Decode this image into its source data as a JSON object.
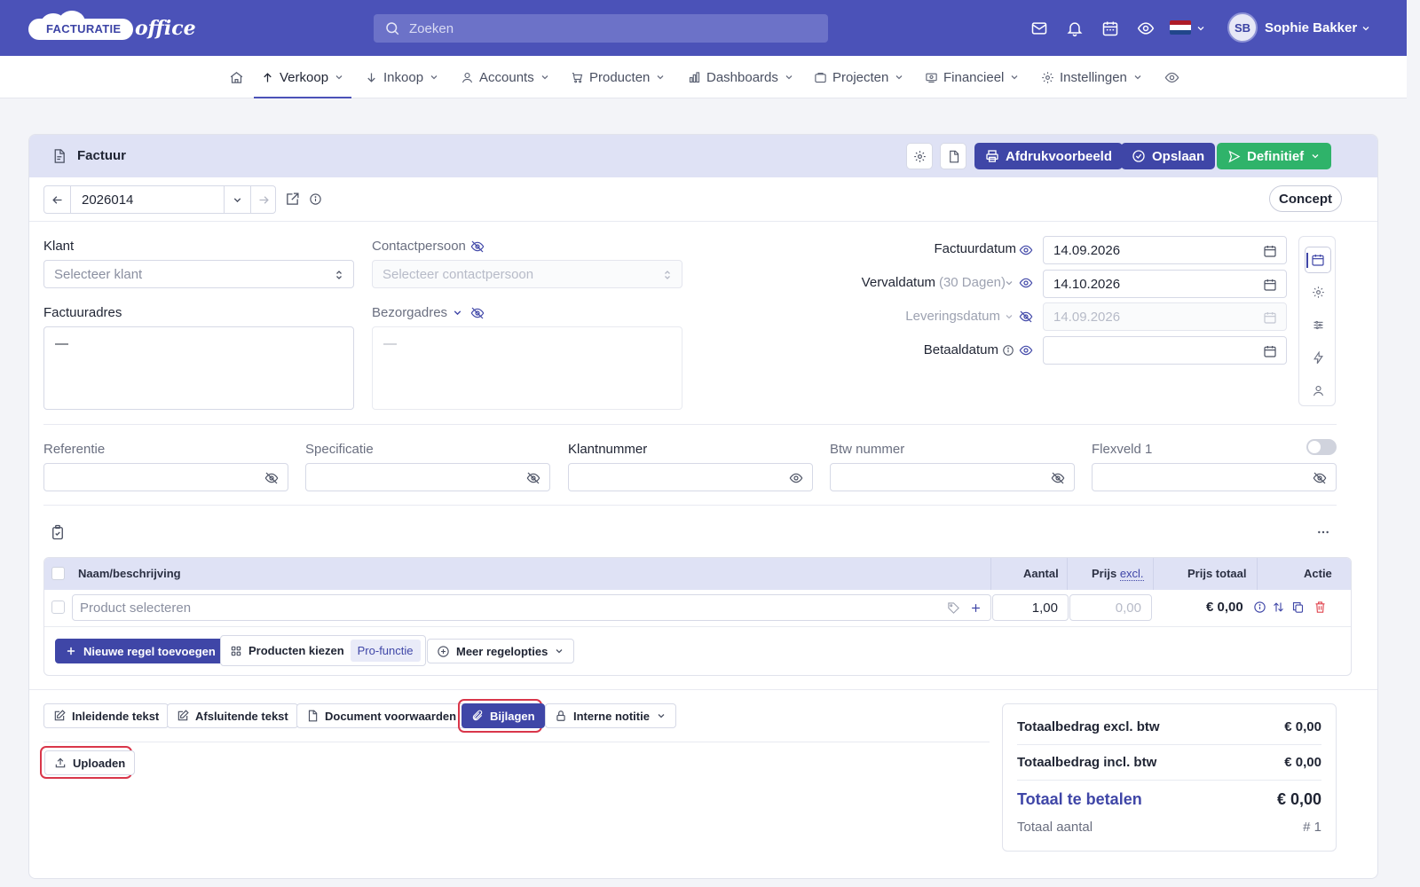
{
  "brand": {
    "logo_text": "FACTURATIE",
    "logo_script": "office"
  },
  "search": {
    "placeholder": "Zoeken"
  },
  "user": {
    "initials": "SB",
    "name": "Sophie Bakker"
  },
  "nav": {
    "items": [
      {
        "label": "Verkoop",
        "active": true
      },
      {
        "label": "Inkoop"
      },
      {
        "label": "Accounts"
      },
      {
        "label": "Producten"
      },
      {
        "label": "Dashboards"
      },
      {
        "label": "Projecten"
      },
      {
        "label": "Financieel"
      },
      {
        "label": "Instellingen"
      }
    ]
  },
  "doc": {
    "title": "Factuur",
    "number": "2026014",
    "status": "Concept",
    "buttons": {
      "preview": "Afdrukvoorbeeld",
      "save": "Opslaan",
      "final": "Definitief"
    }
  },
  "form": {
    "klant_label": "Klant",
    "klant_placeholder": "Selecteer klant",
    "contact_label": "Contactpersoon",
    "contact_placeholder": "Selecteer contactpersoon",
    "factuuradres_label": "Factuuradres",
    "factuuradres_value": "—",
    "bezorgadres_label": "Bezorgadres",
    "bezorgadres_value": "—",
    "factuurdatum_label": "Factuurdatum",
    "factuurdatum_value": "14.09.2026",
    "vervaldatum_label": "Vervaldatum",
    "vervaldatum_hint": "(30 Dagen)",
    "vervaldatum_value": "14.10.2026",
    "leveringsdatum_label": "Leveringsdatum",
    "leveringsdatum_value": "14.09.2026",
    "betaaldatum_label": "Betaaldatum",
    "betaaldatum_value": "",
    "referentie_label": "Referentie",
    "specificatie_label": "Specificatie",
    "klantnummer_label": "Klantnummer",
    "btw_label": "Btw nummer",
    "flexveld_label": "Flexveld 1"
  },
  "lines": {
    "headers": {
      "name": "Naam/beschrijving",
      "qty": "Aantal",
      "price": "Prijs",
      "price_suffix": "excl.",
      "total": "Prijs totaal",
      "action": "Actie"
    },
    "row": {
      "product_placeholder": "Product selecteren",
      "qty": "1,00",
      "price_placeholder": "0,00",
      "total": "€ 0,00"
    },
    "add_line": "Nieuwe regel toevoegen",
    "choose_products": "Producten kiezen",
    "pro_tag": "Pro-functie",
    "more_options": "Meer regelopties"
  },
  "tabs": {
    "intro": "Inleidende tekst",
    "closing": "Afsluitende tekst",
    "terms": "Document voorwaarden",
    "attachments": "Bijlagen",
    "note": "Interne notitie"
  },
  "upload_label": "Uploaden",
  "totals": {
    "excl_label": "Totaalbedrag excl. btw",
    "excl_value": "€ 0,00",
    "incl_label": "Totaalbedrag incl. btw",
    "incl_value": "€ 0,00",
    "due_label": "Totaal te betalen",
    "due_value": "€ 0,00",
    "count_label": "Totaal aantal",
    "count_value": "# 1"
  },
  "colors": {
    "primary": "#4b52b8",
    "button": "#3f46a7",
    "success": "#2fb36a",
    "highlight": "#d9364a"
  }
}
